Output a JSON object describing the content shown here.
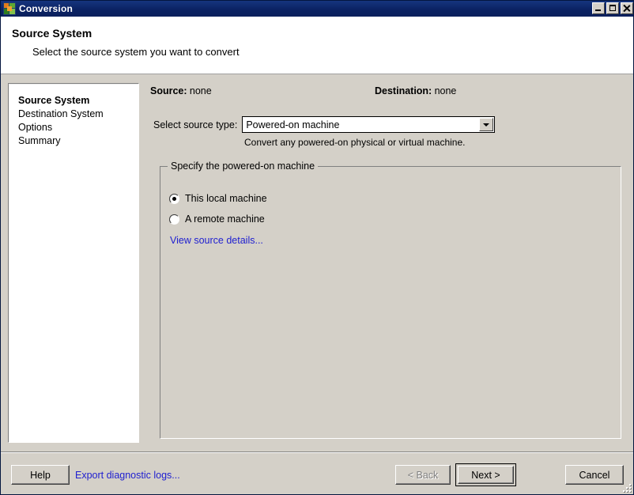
{
  "window": {
    "title": "Conversion",
    "icon": "app-squares-icon",
    "controls": {
      "minimize": "Minimize",
      "maximize": "Maximize",
      "close": "Close"
    }
  },
  "header": {
    "title": "Source System",
    "subtitle": "Select the source system you want to convert"
  },
  "sidebar": {
    "items": [
      {
        "label": "Source System",
        "active": true
      },
      {
        "label": "Destination System",
        "active": false
      },
      {
        "label": "Options",
        "active": false
      },
      {
        "label": "Summary",
        "active": false
      }
    ]
  },
  "main": {
    "source_label": "Source:",
    "source_value": "none",
    "destination_label": "Destination:",
    "destination_value": "none",
    "select_source_type_label": "Select source type:",
    "source_type_value": "Powered-on machine",
    "source_type_options": [
      "Powered-on machine"
    ],
    "source_type_hint": "Convert any powered-on physical or virtual machine.",
    "group_legend": "Specify the powered-on machine",
    "radio_local": "This local machine",
    "radio_remote": "A remote machine",
    "radio_selected": "local",
    "view_source_details": "View source details..."
  },
  "footer": {
    "help": "Help",
    "export_logs": "Export diagnostic logs...",
    "back": "< Back",
    "back_disabled": true,
    "next": "Next >",
    "cancel": "Cancel"
  },
  "colors": {
    "titlebar": "#0b2263",
    "panel": "#d4d0c8",
    "link": "#2020d0",
    "text": "#000000",
    "panel_white": "#ffffff"
  }
}
